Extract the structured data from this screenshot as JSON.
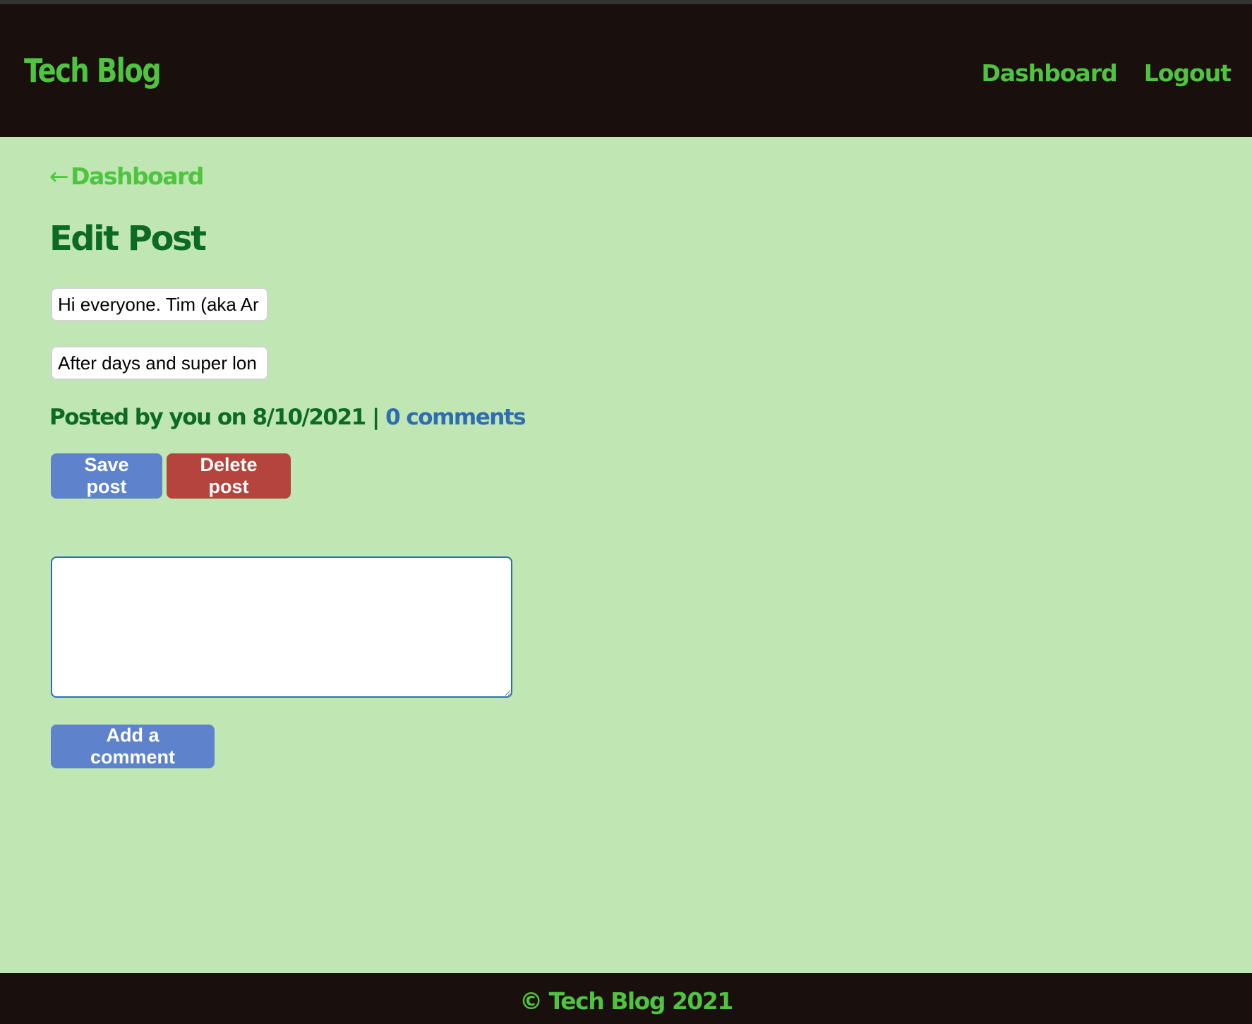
{
  "header": {
    "brand": "Tech Blog",
    "nav": {
      "dashboard": "Dashboard",
      "logout": "Logout"
    }
  },
  "main": {
    "back_arrow": "←",
    "back_label": "Dashboard",
    "title": "Edit Post",
    "post_title_value": "Hi everyone. Tim (aka Ar",
    "post_body_value": "After days and super lon",
    "meta": {
      "text": "Posted by you on 8/10/2021 | ",
      "comments": "0 comments"
    },
    "buttons": {
      "save": "Save post",
      "delete": "Delete post",
      "add_comment": "Add a comment"
    },
    "comment_value": ""
  },
  "footer": {
    "text": "© Tech Blog 2021"
  },
  "colors": {
    "page_background": "#bfe6b3",
    "header_background": "#190f0c",
    "brand_green": "#4ec43f",
    "title_green": "#0c6a22",
    "link_blue": "#2f6db0",
    "primary_button": "#5e83cc",
    "danger_button": "#b5443c"
  }
}
